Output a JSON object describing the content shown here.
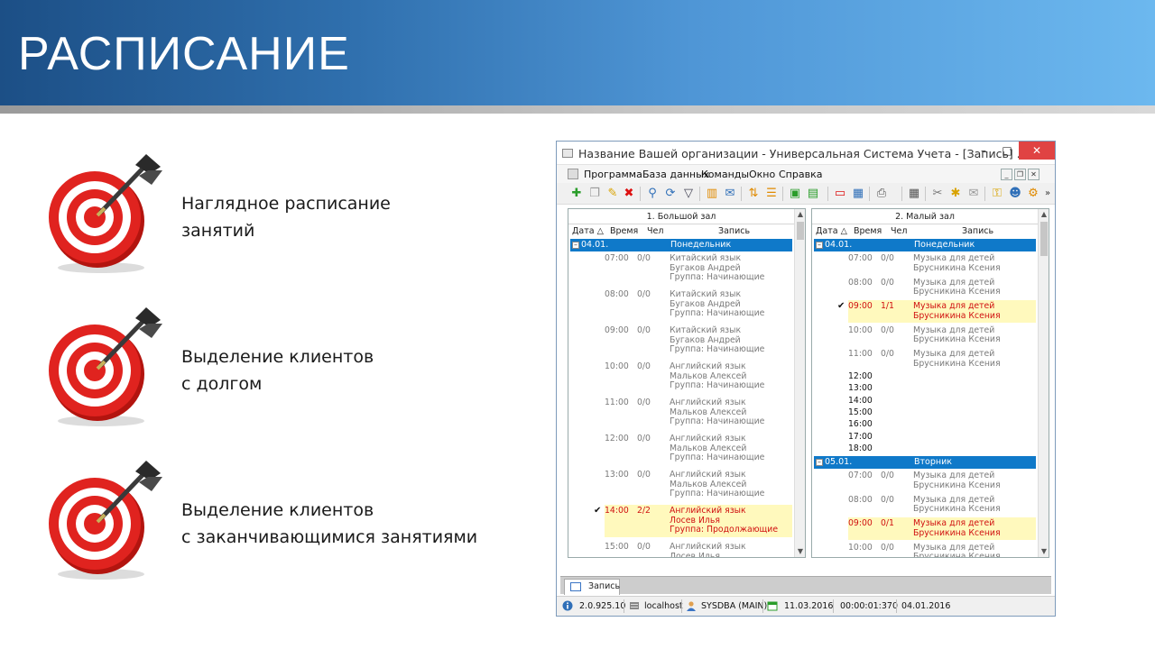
{
  "slide": {
    "title": "РАСПИСАНИЕ",
    "bullets": [
      {
        "line1": "Наглядное расписание",
        "line2": "занятий"
      },
      {
        "line1": "Выделение клиентов",
        "line2": "с долгом"
      },
      {
        "line1": "Выделение  клиентов",
        "line2": "с заканчивающимися занятиями"
      }
    ],
    "colors": {
      "banner_dark": "#1c4f86",
      "banner_light": "#6cb8ef",
      "target_red": "#e0231f"
    }
  },
  "window": {
    "title": "Название Вашей организации - Универсальная Система Учета - [Запись] ...",
    "controls": {
      "minimize": "–",
      "maximize": "□",
      "close": "✕"
    },
    "menu": [
      "Программа",
      "База данных",
      "Команды",
      "Окно",
      "Справка"
    ],
    "mdi": {
      "minimize": "_",
      "restore": "❐",
      "close": "✕"
    },
    "columns": {
      "date": "Дата",
      "time": "Время",
      "people": "Чел",
      "record": "Запись",
      "sort_mark": "△"
    },
    "panel_left": {
      "title": "1. Большой зал",
      "date": "04.01.",
      "day": "Понедельник",
      "entries": [
        {
          "time": "07:00",
          "count": "0/0",
          "l1": "Китайский язык",
          "l2": "Бугаков Андрей",
          "l3": "Группа: Начинающие"
        },
        {
          "time": "08:00",
          "count": "0/0",
          "l1": "Китайский язык",
          "l2": "Бугаков Андрей",
          "l3": "Группа: Начинающие"
        },
        {
          "time": "09:00",
          "count": "0/0",
          "l1": "Китайский язык",
          "l2": "Бугаков Андрей",
          "l3": "Группа: Начинающие"
        },
        {
          "time": "10:00",
          "count": "0/0",
          "l1": "Английский язык",
          "l2": "Мальков Алексей",
          "l3": "Группа: Начинающие"
        },
        {
          "time": "11:00",
          "count": "0/0",
          "l1": "Английский язык",
          "l2": "Мальков Алексей",
          "l3": "Группа: Начинающие"
        },
        {
          "time": "12:00",
          "count": "0/0",
          "l1": "Английский язык",
          "l2": "Мальков Алексей",
          "l3": "Группа: Начинающие"
        },
        {
          "time": "13:00",
          "count": "0/0",
          "l1": "Английский язык",
          "l2": "Мальков Алексей",
          "l3": "Группа: Начинающие"
        },
        {
          "time": "14:00",
          "count": "2/2",
          "l1": "Английский язык",
          "l2": "Лосев Илья",
          "l3": "Группа: Продолжающие",
          "check": "✔"
        },
        {
          "time": "15:00",
          "count": "0/0",
          "l1": "Английский язык",
          "l2": "Лосев Илья",
          "l3": ""
        }
      ]
    },
    "panel_right": {
      "title": "2. Малый зал",
      "day1": {
        "date": "04.01.",
        "day": "Понедельник"
      },
      "entries1": [
        {
          "time": "07:00",
          "count": "0/0",
          "l1": "Музыка для детей",
          "l2": "Брусникина Ксения"
        },
        {
          "time": "08:00",
          "count": "0/0",
          "l1": "Музыка для детей",
          "l2": "Брусникина Ксения"
        },
        {
          "time": "09:00",
          "count": "1/1",
          "l1": "Музыка для детей",
          "l2": "Брусникина Ксения",
          "check": "✔"
        },
        {
          "time": "10:00",
          "count": "0/0",
          "l1": "Музыка для детей",
          "l2": "Брусникина Ксения"
        },
        {
          "time": "11:00",
          "count": "0/0",
          "l1": "Музыка для детей",
          "l2": "Брусникина Ксения"
        }
      ],
      "free_slots": [
        "12:00",
        "13:00",
        "14:00",
        "15:00",
        "16:00",
        "17:00",
        "18:00"
      ],
      "day2": {
        "date": "05.01.",
        "day": "Вторник"
      },
      "entries2": [
        {
          "time": "07:00",
          "count": "0/0",
          "l1": "Музыка для детей",
          "l2": "Брусникина Ксения"
        },
        {
          "time": "08:00",
          "count": "0/0",
          "l1": "Музыка для детей",
          "l2": "Брусникина Ксения"
        },
        {
          "time": "09:00",
          "count": "0/1",
          "l1": "Музыка для детей",
          "l2": "Брусникина Ксения"
        },
        {
          "time": "10:00",
          "count": "0/0",
          "l1": "Музыка для детей",
          "l2": "Брусникина Ксения"
        }
      ]
    },
    "tab": "Запись",
    "status": {
      "version": "2.0.925.10",
      "host": "localhost",
      "user": "SYSDBA (MAIN)",
      "date": "11.03.2016",
      "timer": "00:00:01:370",
      "current": "04.01.2016"
    }
  }
}
